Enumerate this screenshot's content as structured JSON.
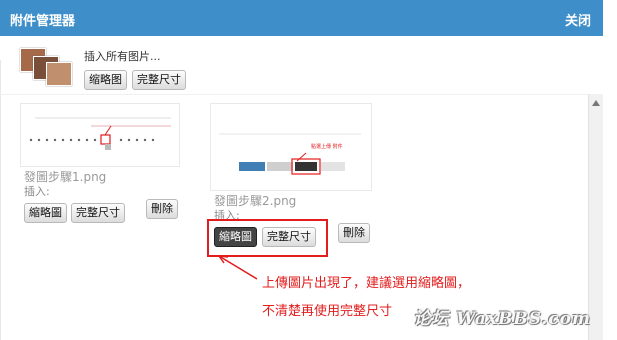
{
  "header": {
    "title": "附件管理器",
    "close_label": "关闭",
    "bg_color": "#3e8fc9"
  },
  "insert_all": {
    "label": "插入所有图片...",
    "thumb_button": "缩略图",
    "full_button": "完整尺寸"
  },
  "attachments": [
    {
      "filename": "發圖步驟1.png",
      "insert_label": "插入:",
      "thumb_button": "縮略圖",
      "full_button": "完整尺寸",
      "delete_button": "刪除"
    },
    {
      "filename": "發圖步驟2.png",
      "insert_label": "插入:",
      "thumb_button": "縮略圖",
      "full_button": "完整尺寸",
      "delete_button": "刪除"
    }
  ],
  "annotation": {
    "line1": "上傳圖片出現了，建議選用縮略圖，",
    "line2": "不清楚再使用完整尺寸",
    "color": "#e31c1c"
  },
  "watermark": "论坛 WaxBBS.com"
}
